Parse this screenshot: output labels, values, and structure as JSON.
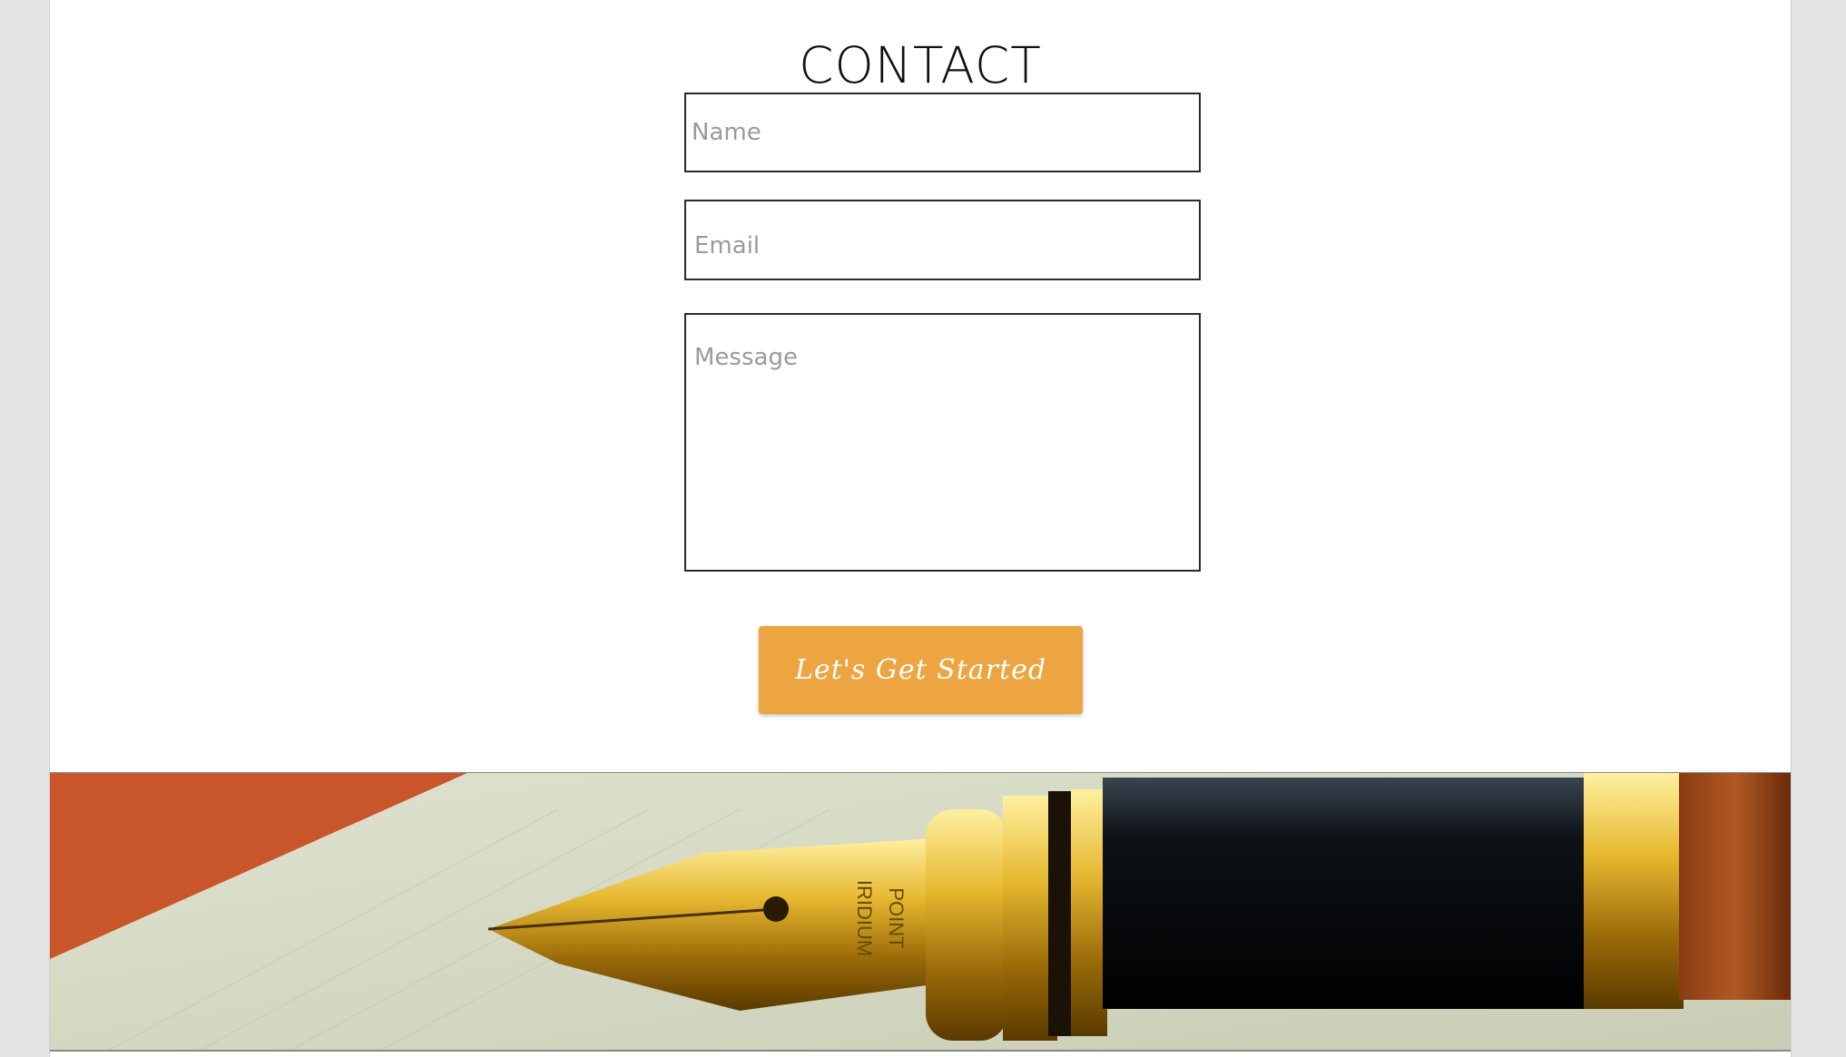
{
  "contact": {
    "title": "CONTACT",
    "name_placeholder": "Name",
    "email_placeholder": "Email",
    "message_placeholder": "Message",
    "submit_label": "Let's Get Started"
  },
  "banner": {
    "image": "fountain-pen-photo",
    "nib_engraving": [
      "IRIDIUM",
      "POINT"
    ]
  },
  "colors": {
    "accent": "#eca540",
    "page_background": "#ffffff",
    "outer_background": "#e4e4e4",
    "field_border": "#2a2a2a"
  }
}
